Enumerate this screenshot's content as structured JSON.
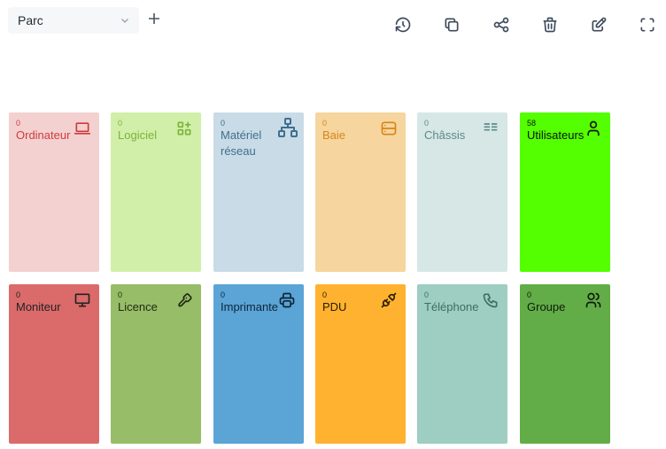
{
  "dashboard": {
    "selected": "Parc",
    "toolbar": {
      "icons": [
        "history-icon",
        "copy-icon",
        "share-icon",
        "trash-icon",
        "edit-icon",
        "fullscreen-icon"
      ]
    }
  },
  "cards": [
    {
      "count": "0",
      "label": "Ordinateur",
      "icon": "laptop-icon",
      "bg": "#f3d1d1",
      "fg": "#d03b3b"
    },
    {
      "count": "0",
      "label": "Logiciel",
      "icon": "apps-add-icon",
      "bg": "#d1efa8",
      "fg": "#7ab33a"
    },
    {
      "count": "0",
      "label": "Matériel réseau",
      "icon": "network-icon",
      "bg": "#c8dbe6",
      "fg": "#3f6f8f"
    },
    {
      "count": "0",
      "label": "Baie",
      "icon": "server-icon",
      "bg": "#f6d59e",
      "fg": "#d68618"
    },
    {
      "count": "0",
      "label": "Châssis",
      "icon": "chassis-icon",
      "bg": "#d6e7e6",
      "fg": "#5a8b89"
    },
    {
      "count": "58",
      "label": "Utilisateurs",
      "icon": "user-icon",
      "bg": "#53ff00",
      "fg": "#111111"
    },
    {
      "count": "0",
      "label": "Moniteur",
      "icon": "monitor-icon",
      "bg": "#db6a6a",
      "fg": "#222222"
    },
    {
      "count": "0",
      "label": "Licence",
      "icon": "key-icon",
      "bg": "#97bd68",
      "fg": "#1f2a12"
    },
    {
      "count": "0",
      "label": "Imprimante",
      "icon": "printer-icon",
      "bg": "#5aa4d6",
      "fg": "#0e2538"
    },
    {
      "count": "0",
      "label": "PDU",
      "icon": "plug-icon",
      "bg": "#ffb22f",
      "fg": "#2a1c02"
    },
    {
      "count": "0",
      "label": "Téléphone",
      "icon": "phone-icon",
      "bg": "#9ecdc1",
      "fg": "#3e6d65"
    },
    {
      "count": "0",
      "label": "Groupe",
      "icon": "users-icon",
      "bg": "#62ad47",
      "fg": "#101c0b"
    }
  ]
}
